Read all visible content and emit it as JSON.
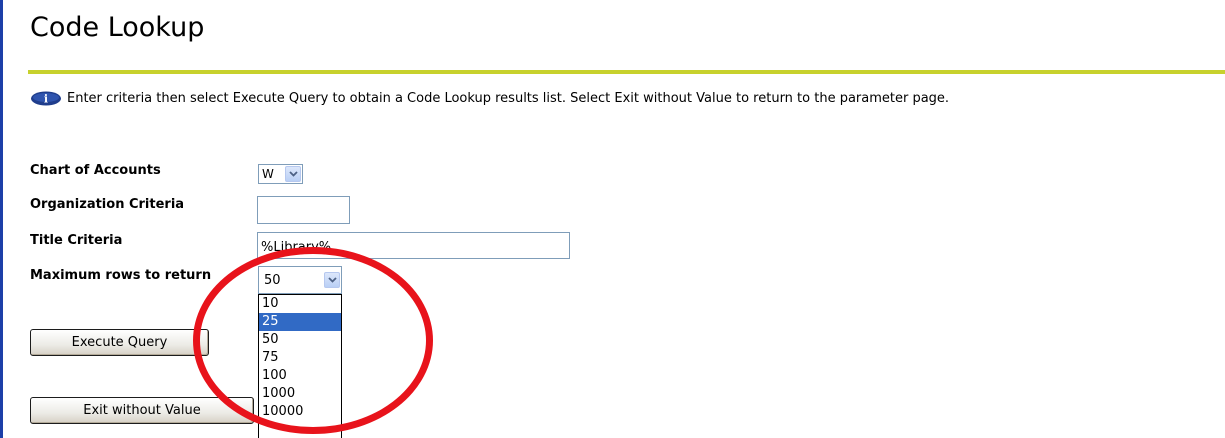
{
  "page": {
    "title": "Code Lookup",
    "info_text": "Enter criteria then select Execute Query to obtain a Code Lookup results list. Select Exit without Value to return to the parameter page."
  },
  "form": {
    "chart_of_accounts": {
      "label": "Chart of Accounts",
      "value": "W"
    },
    "organization_criteria": {
      "label": "Organization Criteria",
      "value": ""
    },
    "title_criteria": {
      "label": "Title Criteria",
      "value": "%Library%"
    },
    "max_rows": {
      "label": "Maximum rows to return",
      "value": "50",
      "options": [
        "10",
        "25",
        "50",
        "75",
        "100",
        "1000",
        "10000"
      ],
      "highlighted_option": "25"
    }
  },
  "buttons": {
    "execute": "Execute Query",
    "exit": "Exit without Value"
  },
  "colors": {
    "left_bar": "#1c3fa8",
    "title_rule": "#c7d12d",
    "highlight": "#316ac5",
    "annotation_circle": "#e8131b"
  },
  "icons": {
    "info": "info-icon",
    "dropdown": "chevron-down-icon"
  }
}
